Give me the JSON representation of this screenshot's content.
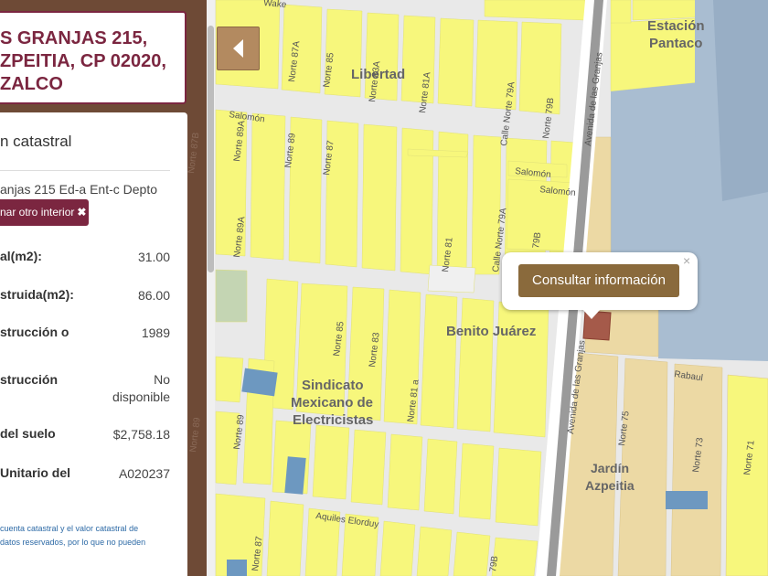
{
  "address": {
    "lines": [
      "S GRANJAS 215,",
      "ZPEITIA, CP 02020,",
      "ZALCO"
    ]
  },
  "info_card": {
    "title": "n catastral",
    "sub_address": "anjas 215 Ed-a Ent-c Depto",
    "other_interior_label": "nar otro interior",
    "rows": [
      {
        "label": "al(m2):",
        "value": "31.00"
      },
      {
        "label": "struida(m2):",
        "value": "86.00"
      },
      {
        "label": "strucción o",
        "value": "1989"
      },
      {
        "label": "strucción",
        "value_line1": "No",
        "value_line2": "disponible"
      },
      {
        "label": "del suelo",
        "value": "$2,758.18"
      },
      {
        "label": "Unitario del",
        "value": "A020237"
      }
    ],
    "note_line1": "cuenta catastral y el valor catastral de",
    "note_line2": "datos reservados, por lo que no pueden"
  },
  "popup": {
    "button_label": "Consultar información",
    "close_symbol": "×"
  },
  "map": {
    "colors": {
      "block_yellow": "#f7f77c",
      "block_tan": "#ecd9a4",
      "block_blue": "#a9bdd1",
      "street": "#e9e9e9",
      "green": "#c4d5b3",
      "water_blue": "#6d98c0",
      "avenue": "#9a9a9a",
      "selected_parcel": "#a55a4a"
    },
    "labels": {
      "libertad": "Libertad",
      "estacion_1": "Estación",
      "estacion_2": "Pantaco",
      "benito": "Benito Juárez",
      "sindicato_1": "Sindicato",
      "sindicato_2": "Mexicano de",
      "sindicato_3": "Electricistas",
      "jardin_1": "Jardín",
      "jardin_2": "Azpeitia"
    },
    "streets": {
      "salomon_w": "Salomón",
      "salomon_e1": "Salomón",
      "salomon_e2": "Salomón",
      "norte_87a": "Norte 87A",
      "norte_85_top": "Norte 85",
      "norte_83a": "Norte 83A",
      "norte_81a": "Norte 81A",
      "norte_81": "Norte 81",
      "calle_norte_79a_top": "Calle Norte 79A",
      "norte_79b_top": "Norte 79B",
      "norte_89a": "Norte 89A",
      "norte_89": "Norte 89",
      "norte_87": "Norte 87",
      "norte_83a_mid": "Norte 83A",
      "calle_norte_79a_mid": "Calle Norte 79A",
      "norte_79b_mid": "79B",
      "avenida_granjas_top": "Avenida de las Granjas",
      "avenida_granjas_bottom": "Avenida de las Granjas",
      "norte_85_mid": "Norte 85",
      "norte_83": "Norte 83",
      "norte_81a_low": "Norte 81 a",
      "norte_89_low": "Norte 89",
      "rabaul": "Rabaul",
      "norte_75": "Norte 75",
      "norte_73": "Norte 73",
      "norte_71": "Norte 71",
      "aquiles": "Aquiles Elorduy",
      "norte_87_low": "Norte 87",
      "norte_79b_low": "79B",
      "norte_89a_left": "Norte 89A",
      "norte_87b_left": "Norte 87B",
      "norte_89_left": "Norte 89",
      "wake": "Wake"
    }
  }
}
